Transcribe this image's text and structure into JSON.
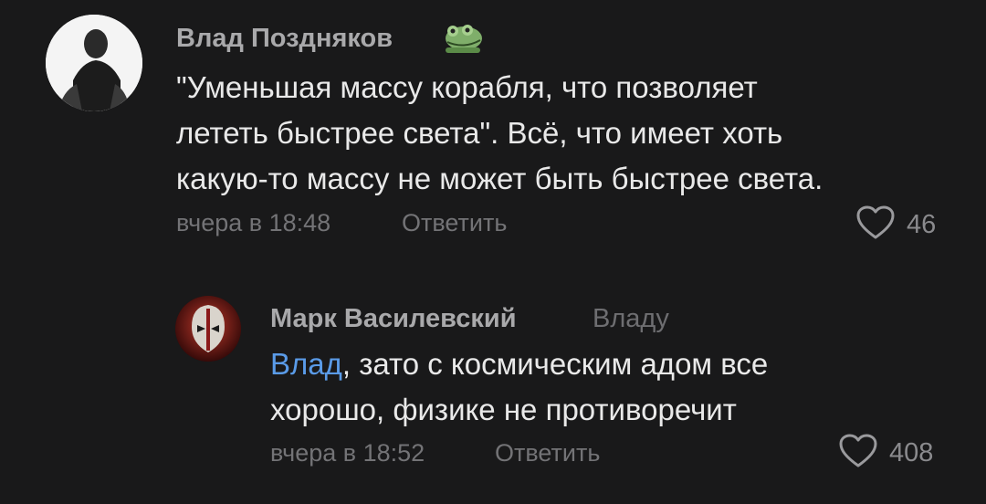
{
  "comments": [
    {
      "author": "Влад Поздняков",
      "text_lines": [
        "\"Уменьшая массу корабля, что позволяет",
        "лететь быстрее света\". Всё, что имеет хоть",
        "какую-то массу не может быть быстрее света."
      ],
      "time": "вчера в 18:48",
      "reply_label": "Ответить",
      "likes": "46",
      "badge_icon": "frog-sticker-icon"
    },
    {
      "author": "Марк Василевский",
      "reply_to": "Владу",
      "mention": "Влад",
      "text_line1_rest": ", зато с космическим адом все",
      "text_line2": "хорошо, физике не противоречит",
      "time": "вчера в 18:52",
      "reply_label": "Ответить",
      "likes": "408"
    }
  ],
  "colors": {
    "background": "#19191a",
    "mention": "#5a9be8",
    "meta": "#737376"
  }
}
